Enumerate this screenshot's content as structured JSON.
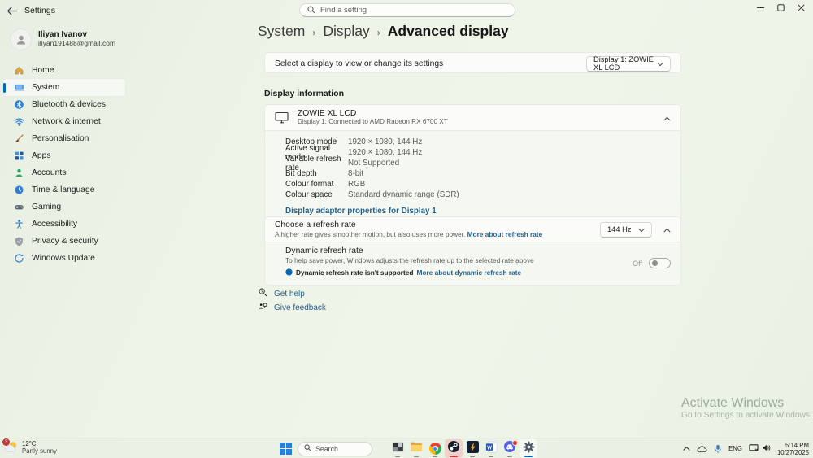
{
  "colors": {
    "accent": "#0067c0",
    "link": "#29618b",
    "attention": "#d13438"
  },
  "window": {
    "title": "Settings"
  },
  "search": {
    "placeholder": "Find a setting"
  },
  "user": {
    "name": "Iliyan Ivanov",
    "email": "iliyan191488@gmail.com"
  },
  "sidebar": {
    "items": [
      {
        "label": "Home"
      },
      {
        "label": "System"
      },
      {
        "label": "Bluetooth & devices"
      },
      {
        "label": "Network & internet"
      },
      {
        "label": "Personalisation"
      },
      {
        "label": "Apps"
      },
      {
        "label": "Accounts"
      },
      {
        "label": "Time & language"
      },
      {
        "label": "Gaming"
      },
      {
        "label": "Accessibility"
      },
      {
        "label": "Privacy & security"
      },
      {
        "label": "Windows Update"
      }
    ]
  },
  "breadcrumb": {
    "level1": "System",
    "level2": "Display",
    "level3": "Advanced display",
    "separator": "›"
  },
  "display_select": {
    "label": "Select a display to view or change its settings",
    "value": "Display 1: ZOWIE XL LCD"
  },
  "display_info": {
    "section_title": "Display information",
    "name": "ZOWIE XL LCD",
    "connection": "Display 1: Connected to AMD Radeon RX 6700 XT",
    "rows": [
      {
        "label": "Desktop mode",
        "value": "1920 × 1080, 144 Hz"
      },
      {
        "label": "Active signal mode",
        "value": "1920 × 1080, 144 Hz"
      },
      {
        "label": "Variable refresh rate",
        "value": "Not Supported"
      },
      {
        "label": "Bit depth",
        "value": "8-bit"
      },
      {
        "label": "Colour format",
        "value": "RGB"
      },
      {
        "label": "Colour space",
        "value": "Standard dynamic range (SDR)"
      }
    ],
    "adapter_link": "Display adaptor properties for Display 1"
  },
  "refresh_rate": {
    "title": "Choose a refresh rate",
    "description": "A higher rate gives smoother motion, but also uses more power.",
    "link": "More about refresh rate",
    "value": "144 Hz"
  },
  "dynamic_refresh": {
    "title": "Dynamic refresh rate",
    "description": "To help save power, Windows adjusts the refresh rate up to the selected rate above",
    "info": "Dynamic refresh rate isn't supported",
    "link": "More about dynamic refresh rate",
    "toggle_label": "Off"
  },
  "footer_links": {
    "get_help": "Get help",
    "give_feedback": "Give feedback"
  },
  "watermark": {
    "line1": "Activate Windows",
    "line2": "Go to Settings to activate Windows."
  },
  "taskbar": {
    "weather": {
      "temp": "12°C",
      "condition": "Partly sunny",
      "badge": "3"
    },
    "search_placeholder": "Search",
    "tray": {
      "language": "ENG",
      "time": "5:14 PM",
      "date": "10/27/2025"
    }
  },
  "icons": {
    "back": "arrow-left",
    "search": "magnifier",
    "minimize": "line",
    "maximize": "square",
    "close": "x",
    "chevron_down": "v",
    "chevron_up": "^",
    "info": "circled-i",
    "monitor": "display-outline",
    "toggle": "switch-off",
    "start": "windows-logo",
    "onedrive": "cloud",
    "microphone": "mic",
    "volume": "speaker",
    "display_tray": "screen"
  }
}
